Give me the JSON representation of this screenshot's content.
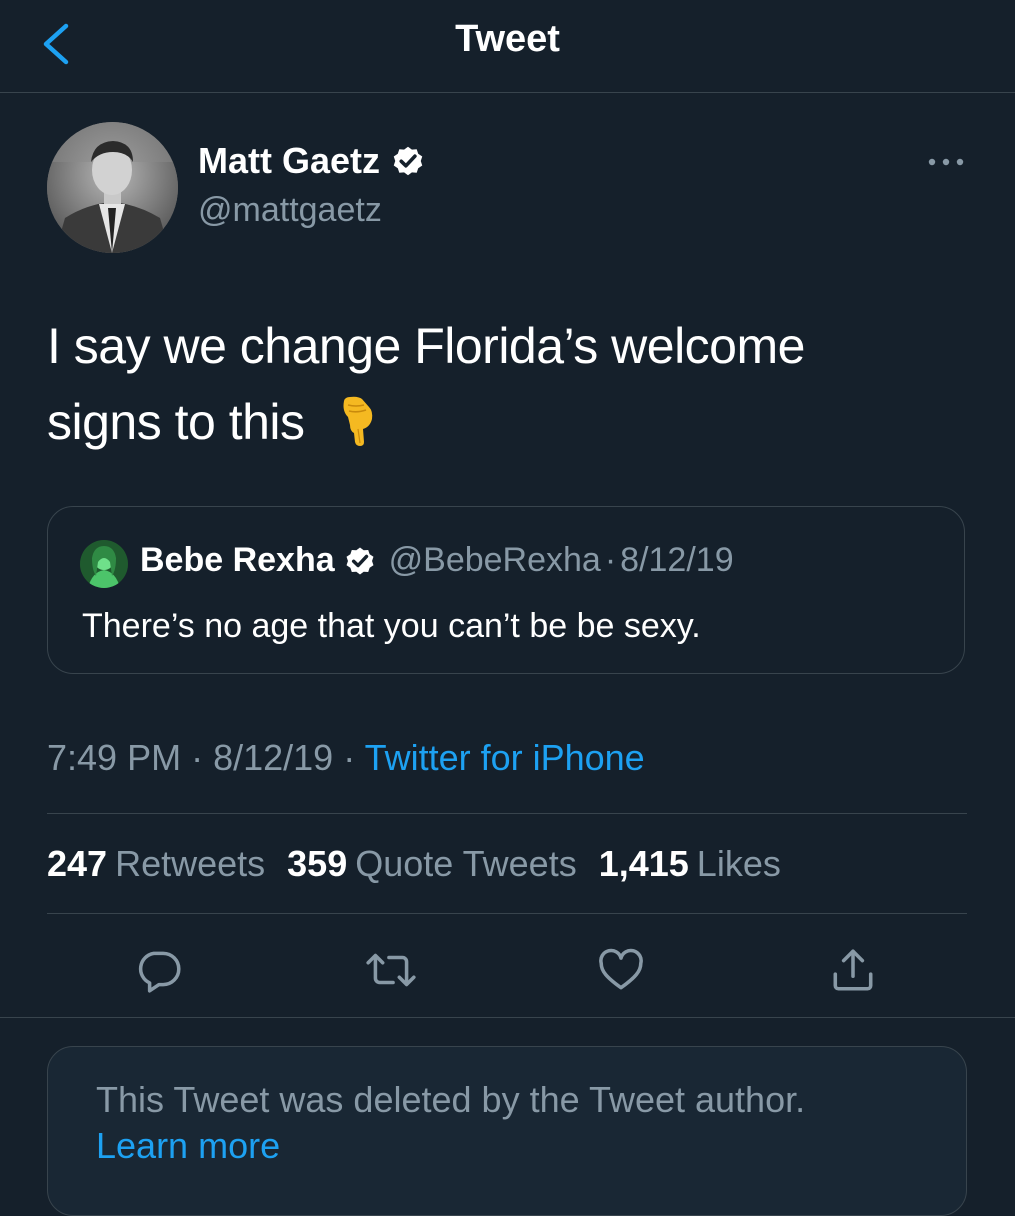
{
  "header": {
    "title": "Tweet"
  },
  "author": {
    "display_name": "Matt Gaetz",
    "handle": "@mattgaetz",
    "verified": true
  },
  "tweet": {
    "text_line1": "I say we change Florida’s welcome",
    "text_line2": "signs to this",
    "emoji": "backhand-index-pointing-down",
    "time": "7:49 PM",
    "date": "8/12/19",
    "source": "Twitter for iPhone"
  },
  "quoted_tweet": {
    "display_name": "Bebe Rexha",
    "handle": "@BebeRexha",
    "date": "8/12/19",
    "verified": true,
    "text": "There’s no age that you can’t be be sexy."
  },
  "stats": {
    "retweets_count": "247",
    "retweets_label": "Retweets",
    "quotes_count": "359",
    "quotes_label": "Quote Tweets",
    "likes_count": "1,415",
    "likes_label": "Likes"
  },
  "actions": [
    "reply-icon",
    "retweet-icon",
    "like-icon",
    "share-icon"
  ],
  "notice": {
    "text": "This Tweet was deleted by the Tweet author.",
    "link": "Learn more"
  },
  "colors": {
    "background": "#15202b",
    "accent": "#1da1f2",
    "secondary_text": "#8899a6",
    "border": "#38444d"
  }
}
